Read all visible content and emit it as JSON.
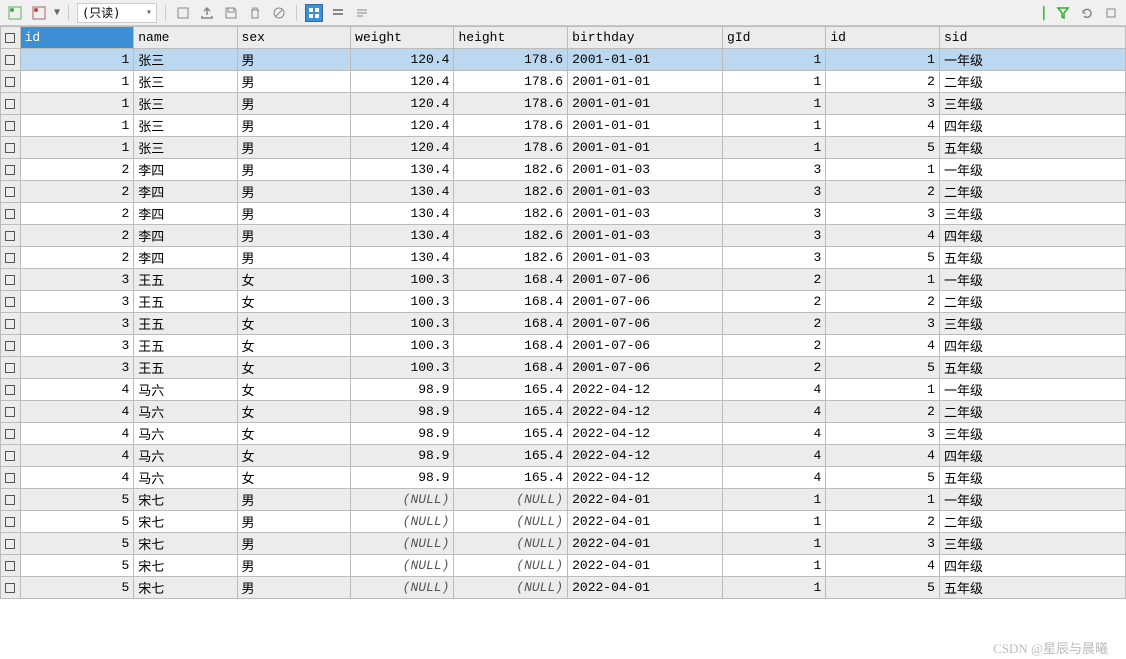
{
  "toolbar": {
    "mode_label": "(只读)"
  },
  "watermark": "CSDN @星辰与晨曦",
  "columns": [
    "id",
    "name",
    "sex",
    "weight",
    "height",
    "birthday",
    "gId",
    "id",
    "sid"
  ],
  "rows": [
    {
      "sel": true,
      "id": "1",
      "name": "张三",
      "sex": "男",
      "weight": "120.4",
      "height": "178.6",
      "birthday": "2001-01-01",
      "gid": "1",
      "id2": "1",
      "sid": "一年级"
    },
    {
      "sel": false,
      "alt": false,
      "id": "1",
      "name": "张三",
      "sex": "男",
      "weight": "120.4",
      "height": "178.6",
      "birthday": "2001-01-01",
      "gid": "1",
      "id2": "2",
      "sid": "二年级"
    },
    {
      "sel": false,
      "alt": true,
      "id": "1",
      "name": "张三",
      "sex": "男",
      "weight": "120.4",
      "height": "178.6",
      "birthday": "2001-01-01",
      "gid": "1",
      "id2": "3",
      "sid": "三年级"
    },
    {
      "sel": false,
      "alt": false,
      "id": "1",
      "name": "张三",
      "sex": "男",
      "weight": "120.4",
      "height": "178.6",
      "birthday": "2001-01-01",
      "gid": "1",
      "id2": "4",
      "sid": "四年级"
    },
    {
      "sel": false,
      "alt": true,
      "id": "1",
      "name": "张三",
      "sex": "男",
      "weight": "120.4",
      "height": "178.6",
      "birthday": "2001-01-01",
      "gid": "1",
      "id2": "5",
      "sid": "五年级"
    },
    {
      "sel": false,
      "alt": false,
      "id": "2",
      "name": "李四",
      "sex": "男",
      "weight": "130.4",
      "height": "182.6",
      "birthday": "2001-01-03",
      "gid": "3",
      "id2": "1",
      "sid": "一年级"
    },
    {
      "sel": false,
      "alt": true,
      "id": "2",
      "name": "李四",
      "sex": "男",
      "weight": "130.4",
      "height": "182.6",
      "birthday": "2001-01-03",
      "gid": "3",
      "id2": "2",
      "sid": "二年级"
    },
    {
      "sel": false,
      "alt": false,
      "id": "2",
      "name": "李四",
      "sex": "男",
      "weight": "130.4",
      "height": "182.6",
      "birthday": "2001-01-03",
      "gid": "3",
      "id2": "3",
      "sid": "三年级"
    },
    {
      "sel": false,
      "alt": true,
      "id": "2",
      "name": "李四",
      "sex": "男",
      "weight": "130.4",
      "height": "182.6",
      "birthday": "2001-01-03",
      "gid": "3",
      "id2": "4",
      "sid": "四年级"
    },
    {
      "sel": false,
      "alt": false,
      "id": "2",
      "name": "李四",
      "sex": "男",
      "weight": "130.4",
      "height": "182.6",
      "birthday": "2001-01-03",
      "gid": "3",
      "id2": "5",
      "sid": "五年级"
    },
    {
      "sel": false,
      "alt": true,
      "id": "3",
      "name": "王五",
      "sex": "女",
      "weight": "100.3",
      "height": "168.4",
      "birthday": "2001-07-06",
      "gid": "2",
      "id2": "1",
      "sid": "一年级"
    },
    {
      "sel": false,
      "alt": false,
      "id": "3",
      "name": "王五",
      "sex": "女",
      "weight": "100.3",
      "height": "168.4",
      "birthday": "2001-07-06",
      "gid": "2",
      "id2": "2",
      "sid": "二年级"
    },
    {
      "sel": false,
      "alt": true,
      "id": "3",
      "name": "王五",
      "sex": "女",
      "weight": "100.3",
      "height": "168.4",
      "birthday": "2001-07-06",
      "gid": "2",
      "id2": "3",
      "sid": "三年级"
    },
    {
      "sel": false,
      "alt": false,
      "id": "3",
      "name": "王五",
      "sex": "女",
      "weight": "100.3",
      "height": "168.4",
      "birthday": "2001-07-06",
      "gid": "2",
      "id2": "4",
      "sid": "四年级"
    },
    {
      "sel": false,
      "alt": true,
      "id": "3",
      "name": "王五",
      "sex": "女",
      "weight": "100.3",
      "height": "168.4",
      "birthday": "2001-07-06",
      "gid": "2",
      "id2": "5",
      "sid": "五年级"
    },
    {
      "sel": false,
      "alt": false,
      "id": "4",
      "name": "马六",
      "sex": "女",
      "weight": "98.9",
      "height": "165.4",
      "birthday": "2022-04-12",
      "gid": "4",
      "id2": "1",
      "sid": "一年级"
    },
    {
      "sel": false,
      "alt": true,
      "id": "4",
      "name": "马六",
      "sex": "女",
      "weight": "98.9",
      "height": "165.4",
      "birthday": "2022-04-12",
      "gid": "4",
      "id2": "2",
      "sid": "二年级"
    },
    {
      "sel": false,
      "alt": false,
      "id": "4",
      "name": "马六",
      "sex": "女",
      "weight": "98.9",
      "height": "165.4",
      "birthday": "2022-04-12",
      "gid": "4",
      "id2": "3",
      "sid": "三年级"
    },
    {
      "sel": false,
      "alt": true,
      "id": "4",
      "name": "马六",
      "sex": "女",
      "weight": "98.9",
      "height": "165.4",
      "birthday": "2022-04-12",
      "gid": "4",
      "id2": "4",
      "sid": "四年级"
    },
    {
      "sel": false,
      "alt": false,
      "id": "4",
      "name": "马六",
      "sex": "女",
      "weight": "98.9",
      "height": "165.4",
      "birthday": "2022-04-12",
      "gid": "4",
      "id2": "5",
      "sid": "五年级"
    },
    {
      "sel": false,
      "alt": true,
      "id": "5",
      "name": "宋七",
      "sex": "男",
      "weight": "(NULL)",
      "height": "(NULL)",
      "birthday": "2022-04-01",
      "gid": "1",
      "id2": "1",
      "sid": "一年级",
      "wnull": true,
      "hnull": true
    },
    {
      "sel": false,
      "alt": false,
      "id": "5",
      "name": "宋七",
      "sex": "男",
      "weight": "(NULL)",
      "height": "(NULL)",
      "birthday": "2022-04-01",
      "gid": "1",
      "id2": "2",
      "sid": "二年级",
      "wnull": true,
      "hnull": true
    },
    {
      "sel": false,
      "alt": true,
      "id": "5",
      "name": "宋七",
      "sex": "男",
      "weight": "(NULL)",
      "height": "(NULL)",
      "birthday": "2022-04-01",
      "gid": "1",
      "id2": "3",
      "sid": "三年级",
      "wnull": true,
      "hnull": true
    },
    {
      "sel": false,
      "alt": false,
      "id": "5",
      "name": "宋七",
      "sex": "男",
      "weight": "(NULL)",
      "height": "(NULL)",
      "birthday": "2022-04-01",
      "gid": "1",
      "id2": "4",
      "sid": "四年级",
      "wnull": true,
      "hnull": true
    },
    {
      "sel": false,
      "alt": true,
      "id": "5",
      "name": "宋七",
      "sex": "男",
      "weight": "(NULL)",
      "height": "(NULL)",
      "birthday": "2022-04-01",
      "gid": "1",
      "id2": "5",
      "sid": "五年级",
      "wnull": true,
      "hnull": true
    }
  ]
}
